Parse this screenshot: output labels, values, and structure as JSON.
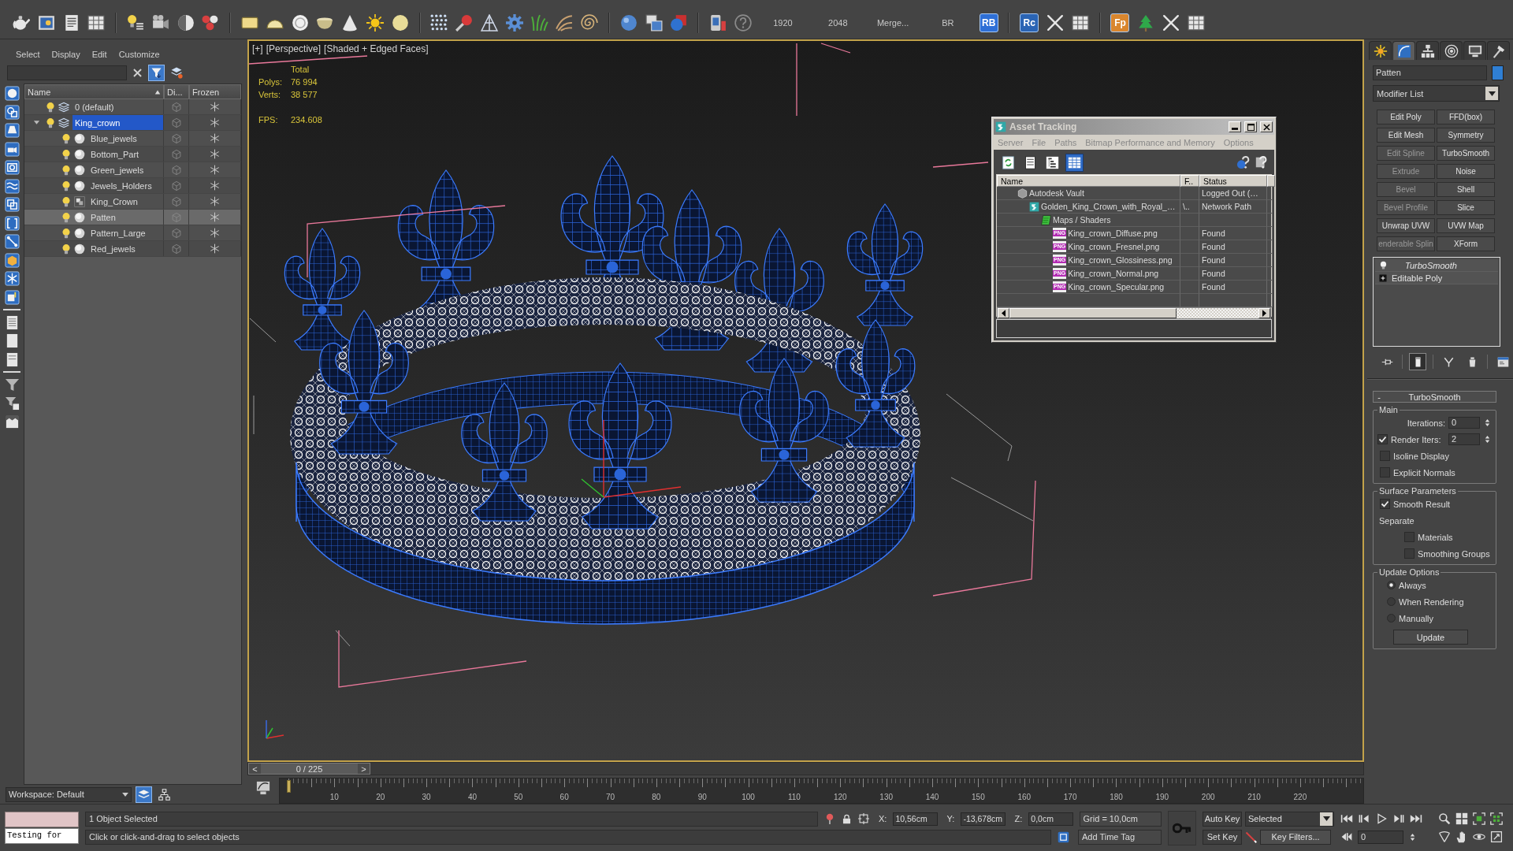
{
  "main_toolbar": {
    "items": [
      {
        "kind": "label",
        "text": "1920"
      },
      {
        "kind": "label",
        "text": "2048"
      },
      {
        "kind": "label",
        "text": "Merge..."
      },
      {
        "kind": "label",
        "text": "BR"
      },
      {
        "kind": "tile",
        "text": "RB",
        "color": "#2e6fd6"
      },
      {
        "kind": "tile",
        "text": "Rc",
        "color": "#2a64b4"
      },
      {
        "kind": "tile",
        "text": "Fp",
        "color": "#d9862e"
      }
    ]
  },
  "scene_explorer": {
    "menu": [
      "Select",
      "Display",
      "Edit",
      "Customize"
    ],
    "filter_toggle": {
      "selected": true
    },
    "columns": [
      "Name",
      "Di...",
      "Frozen"
    ],
    "rows": [
      {
        "kind": "layer",
        "name": "0 (default)",
        "visible": true,
        "current": false,
        "selected": false
      },
      {
        "kind": "layer",
        "name": "King_crown",
        "visible": true,
        "current": true,
        "selected": false,
        "expanded": true,
        "children": [
          {
            "kind": "object",
            "name": "Blue_jewels",
            "visible": true,
            "selected": false
          },
          {
            "kind": "object",
            "name": "Bottom_Part",
            "visible": true,
            "selected": false
          },
          {
            "kind": "object",
            "name": "Green_jewels",
            "visible": true,
            "selected": false
          },
          {
            "kind": "object",
            "name": "Jewels_Holders",
            "visible": true,
            "selected": false
          },
          {
            "kind": "group",
            "name": "King_Crown",
            "visible": true,
            "selected": false
          },
          {
            "kind": "object",
            "name": "Patten",
            "visible": true,
            "selected": true
          },
          {
            "kind": "object",
            "name": "Pattern_Large",
            "visible": true,
            "selected": false
          },
          {
            "kind": "object",
            "name": "Red_jewels",
            "visible": true,
            "selected": false
          }
        ]
      }
    ],
    "workspace": "Workspace: Default",
    "view_tabs": [
      {
        "selected": true
      },
      {
        "selected": false
      }
    ]
  },
  "viewport": {
    "active": true,
    "labels": [
      "[+]",
      "[Perspective]",
      "[Shaded + Edged Faces]"
    ],
    "stats": {
      "header": "Total",
      "rows": [
        {
          "label": "Polys:",
          "value": "76 994"
        },
        {
          "label": "Verts:",
          "value": "38 577"
        }
      ],
      "fps_label": "FPS:",
      "fps_value": "234.608"
    }
  },
  "asset_tracking": {
    "title": "Asset Tracking",
    "menu": [
      "Server",
      "File",
      "Paths",
      "Bitmap Performance and Memory",
      "Options"
    ],
    "toolbar": [
      {
        "selected": false
      },
      {
        "selected": false
      },
      {
        "selected": false
      },
      {
        "selected": true
      }
    ],
    "columns": [
      "Name",
      "F..",
      "Status"
    ],
    "rows": [
      {
        "kind": "vault",
        "name": "Autodesk Vault",
        "status": "Logged Out (…",
        "children": [
          {
            "kind": "scene",
            "name": "Golden_King_Crown_with_Royal_…",
            "path": "\\..",
            "status": "Network Path",
            "children": [
              {
                "kind": "folder",
                "name": "Maps / Shaders",
                "children": [
                  {
                    "kind": "file",
                    "tag": "PNG",
                    "name": "King_crown_Diffuse.png",
                    "status": "Found"
                  },
                  {
                    "kind": "file",
                    "tag": "PNG",
                    "name": "King_crown_Fresnel.png",
                    "status": "Found"
                  },
                  {
                    "kind": "file",
                    "tag": "PNG",
                    "name": "King_crown_Glossiness.png",
                    "status": "Found"
                  },
                  {
                    "kind": "file",
                    "tag": "PNG",
                    "name": "King_crown_Normal.png",
                    "status": "Found"
                  },
                  {
                    "kind": "file",
                    "tag": "PNG",
                    "name": "King_crown_Specular.png",
                    "status": "Found"
                  }
                ]
              }
            ]
          }
        ]
      }
    ]
  },
  "timeline": {
    "prev": "<",
    "next": ">",
    "slider": {
      "label": "0 / 225",
      "level": 0
    },
    "ruler": [
      "10",
      "20",
      "30",
      "40",
      "50",
      "60",
      "70",
      "80",
      "90",
      "100",
      "110",
      "120",
      "130",
      "140",
      "150",
      "160",
      "170",
      "180",
      "190",
      "200",
      "210",
      "220"
    ]
  },
  "command_panel": {
    "tabs": [
      {
        "selected": false
      },
      {
        "selected": true
      },
      {
        "selected": false
      },
      {
        "selected": false
      },
      {
        "selected": false
      },
      {
        "selected": false
      }
    ],
    "object": {
      "name": "Patten",
      "color": "#2f7fd4"
    },
    "modifier_list": "Modifier List",
    "modifier_buttons": [
      {
        "label": "Edit Poly",
        "disabled": false
      },
      {
        "label": "FFD(box)",
        "disabled": false
      },
      {
        "label": "Edit Mesh",
        "disabled": false
      },
      {
        "label": "Symmetry",
        "disabled": false
      },
      {
        "label": "Edit Spline",
        "disabled": true
      },
      {
        "label": "TurboSmooth",
        "disabled": false
      },
      {
        "label": "Extrude",
        "disabled": true
      },
      {
        "label": "Noise",
        "disabled": false
      },
      {
        "label": "Bevel",
        "disabled": true
      },
      {
        "label": "Shell",
        "disabled": false
      },
      {
        "label": "Bevel Profile",
        "disabled": true
      },
      {
        "label": "Slice",
        "disabled": false
      },
      {
        "label": "Unwrap UVW",
        "disabled": false
      },
      {
        "label": "UVW Map",
        "disabled": false
      },
      {
        "label": "enderable Splin",
        "disabled": true
      },
      {
        "label": "XForm",
        "disabled": false
      }
    ],
    "stack": [
      {
        "kind": "modifier",
        "name": "TurboSmooth",
        "on": true
      },
      {
        "kind": "base",
        "name": "Editable Poly",
        "expanded": false
      }
    ],
    "stack_tools": [
      {
        "selected": false
      },
      {
        "selected": true
      },
      {
        "selected": false
      },
      {
        "selected": false
      },
      {
        "selected": false
      }
    ],
    "rollout": {
      "sign": "-",
      "title": "TurboSmooth",
      "groups": [
        {
          "title": "Main",
          "controls": [
            {
              "kind": "spinner",
              "label": "Iterations:",
              "value": "0"
            },
            {
              "kind": "check_spinner",
              "label": "Render Iters:",
              "checked": true,
              "value": "2"
            },
            {
              "kind": "checkbox",
              "label": "Isoline Display",
              "checked": false
            },
            {
              "kind": "checkbox",
              "label": "Explicit Normals",
              "checked": false
            }
          ]
        },
        {
          "title": "Surface Parameters",
          "controls": [
            {
              "kind": "checkbox",
              "label": "Smooth Result",
              "checked": true
            },
            {
              "kind": "label",
              "label": "Separate"
            },
            {
              "kind": "sub_checkbox",
              "label": "Materials",
              "checked": false
            },
            {
              "kind": "sub_checkbox",
              "label": "Smoothing Groups",
              "checked": false
            }
          ]
        },
        {
          "title": "Update Options",
          "controls": [
            {
              "kind": "radio",
              "label": "Always",
              "selected": true
            },
            {
              "kind": "radio",
              "label": "When Rendering",
              "selected": false
            },
            {
              "kind": "radio",
              "label": "Manually",
              "selected": false
            },
            {
              "kind": "button",
              "label": "Update"
            }
          ]
        }
      ]
    }
  },
  "status_bar": {
    "listener": "Testing for",
    "selection": "1 Object Selected",
    "prompt": "Click or click-and-drag to select objects",
    "coords": [
      {
        "axis": "X:",
        "value": "10,56cm"
      },
      {
        "axis": "Y:",
        "value": "-13,678cm"
      },
      {
        "axis": "Z:",
        "value": "0,0cm"
      }
    ],
    "grid": "Grid = 10,0cm",
    "time_tag": "Add Time Tag",
    "auto_key": "Auto Key",
    "key_set": "Selected",
    "set_key": "Set Key",
    "key_filters": "Key Filters...",
    "frame": "0"
  }
}
